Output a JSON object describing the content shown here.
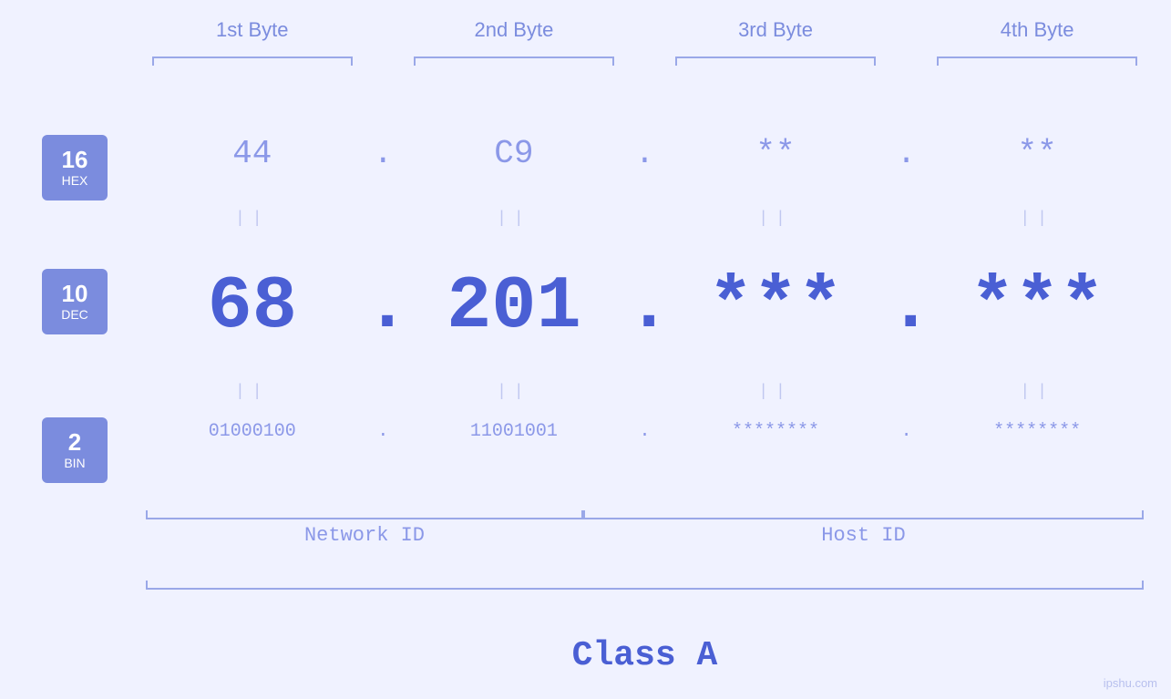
{
  "headers": {
    "col1": "1st Byte",
    "col2": "2nd Byte",
    "col3": "3rd Byte",
    "col4": "4th Byte"
  },
  "badges": {
    "hex": {
      "number": "16",
      "label": "HEX"
    },
    "dec": {
      "number": "10",
      "label": "DEC"
    },
    "bin": {
      "number": "2",
      "label": "BIN"
    }
  },
  "hex_row": {
    "b1": "44",
    "b2": "C9",
    "b3": "**",
    "b4": "**",
    "dot": "."
  },
  "dec_row": {
    "b1": "68",
    "b2": "201",
    "b3": "***",
    "b4": "***",
    "dot": "."
  },
  "bin_row": {
    "b1": "01000100",
    "b2": "11001001",
    "b3": "********",
    "b4": "********",
    "dot": "."
  },
  "labels": {
    "network_id": "Network ID",
    "host_id": "Host ID",
    "class": "Class A"
  },
  "watermark": "ipshu.com",
  "equals": "||"
}
